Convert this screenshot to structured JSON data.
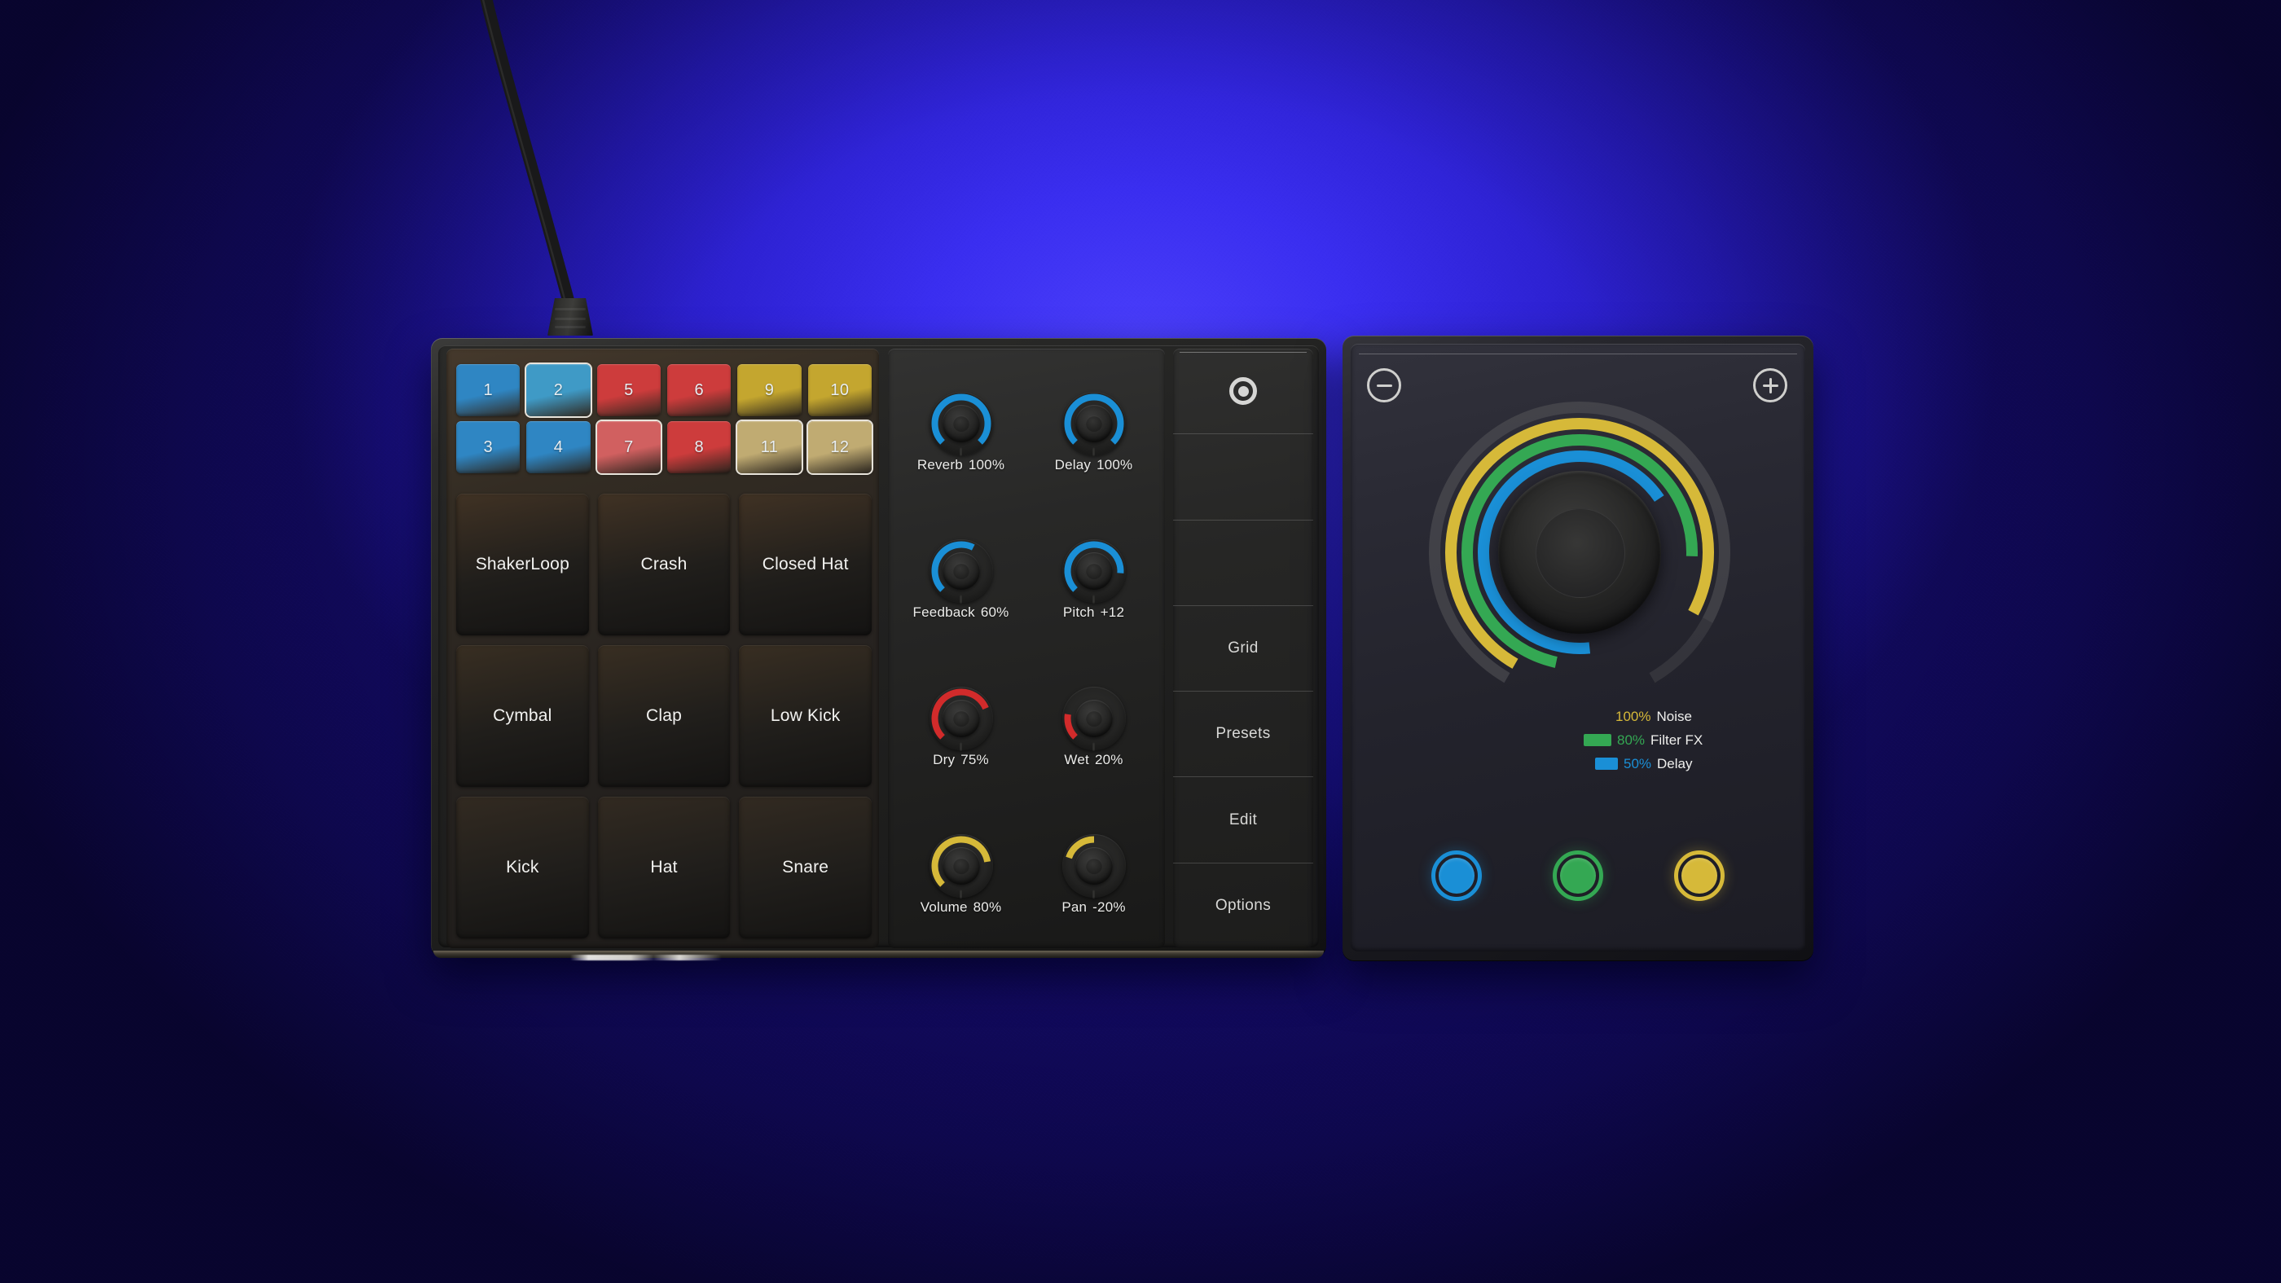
{
  "colors": {
    "pad_blue": "#2f86c3",
    "pad_blue_sel": "#3f9ac6",
    "pad_red": "#cd3c3c",
    "pad_red_sel": "#d16060",
    "pad_yellow": "#c4a62f",
    "pad_yellow_dim": "#c0ab72",
    "knob_blue": "#1a8fd6",
    "knob_red": "#d22b2b",
    "knob_yellow": "#d6b939",
    "ring_green": "#34a853",
    "ring_track": "#55555a",
    "wall_blue": "#2e22d4",
    "wall_blue_hot": "#4a3ffb"
  },
  "device_left": {
    "trigger_pads": [
      {
        "label": "1",
        "color": "#2f86c3",
        "selected": false
      },
      {
        "label": "2",
        "color": "#3f9ac6",
        "selected": true
      },
      {
        "label": "5",
        "color": "#cd3c3c",
        "selected": false
      },
      {
        "label": "6",
        "color": "#cd3c3c",
        "selected": false
      },
      {
        "label": "9",
        "color": "#c4a62f",
        "selected": false
      },
      {
        "label": "10",
        "color": "#c4a62f",
        "selected": false
      },
      {
        "label": "3",
        "color": "#2f86c3",
        "selected": false
      },
      {
        "label": "4",
        "color": "#2f86c3",
        "selected": false
      },
      {
        "label": "7",
        "color": "#d16060",
        "selected": true
      },
      {
        "label": "8",
        "color": "#cd3c3c",
        "selected": false
      },
      {
        "label": "11",
        "color": "#c0ab72",
        "selected": true
      },
      {
        "label": "12",
        "color": "#c0ab72",
        "selected": true
      }
    ],
    "sample_pads": [
      {
        "label": "ShakerLoop"
      },
      {
        "label": "Crash"
      },
      {
        "label": "Closed Hat"
      },
      {
        "label": "Cymbal"
      },
      {
        "label": "Clap"
      },
      {
        "label": "Low Kick"
      },
      {
        "label": "Kick"
      },
      {
        "label": "Hat"
      },
      {
        "label": "Snare"
      }
    ],
    "knobs": [
      {
        "name": "Reverb",
        "value": "100%",
        "pct": 100,
        "color": "#1a8fd6"
      },
      {
        "name": "Delay",
        "value": "100%",
        "pct": 100,
        "color": "#1a8fd6"
      },
      {
        "name": "Feedback",
        "value": "60%",
        "pct": 60,
        "color": "#1a8fd6"
      },
      {
        "name": "Pitch",
        "value": "+12",
        "pct": 85,
        "color": "#1a8fd6"
      },
      {
        "name": "Dry",
        "value": "75%",
        "pct": 75,
        "color": "#d22b2b"
      },
      {
        "name": "Wet",
        "value": "20%",
        "pct": 20,
        "color": "#d22b2b"
      },
      {
        "name": "Volume",
        "value": "80%",
        "pct": 80,
        "color": "#d6b939"
      },
      {
        "name": "Pan",
        "value": "-20%",
        "pct": -20,
        "color": "#d6b939"
      }
    ],
    "menu": {
      "record_icon": "record-icon",
      "items": [
        "",
        "",
        "",
        "Grid",
        "Presets",
        "Edit",
        "Options"
      ]
    }
  },
  "device_right": {
    "minus_label": "minus-icon",
    "plus_label": "plus-icon",
    "rings": [
      {
        "name": "Noise",
        "pct_label": "100%",
        "pct": 100,
        "color": "#d6b939"
      },
      {
        "name": "Filter FX",
        "pct_label": "80%",
        "pct": 80,
        "color": "#34a853"
      },
      {
        "name": "Delay",
        "pct_label": "50%",
        "pct": 50,
        "color": "#1a8fd6"
      }
    ],
    "circle_buttons": [
      {
        "name": "delay-button",
        "color": "#1a8fd6"
      },
      {
        "name": "filter-button",
        "color": "#34a853"
      },
      {
        "name": "noise-button",
        "color": "#d6b939"
      }
    ]
  },
  "chart_data": {
    "type": "pie",
    "title": "Multi-ring FX level display",
    "series": [
      {
        "name": "Noise",
        "value": 100,
        "unit": "%",
        "color": "#d6b939"
      },
      {
        "name": "Filter FX",
        "value": 80,
        "unit": "%",
        "color": "#34a853"
      },
      {
        "name": "Delay",
        "value": 50,
        "unit": "%",
        "color": "#1a8fd6"
      }
    ],
    "legend_position": "bottom-right",
    "ylim": [
      0,
      100
    ]
  }
}
